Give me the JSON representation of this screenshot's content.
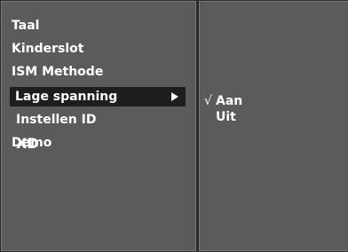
{
  "menu": {
    "items": [
      {
        "label": "Taal"
      },
      {
        "label": "Kinderslot"
      },
      {
        "label": "ISM Methode"
      },
      {
        "label": "Lage spanning"
      },
      {
        "label": "Instellen ID"
      },
      {
        "label": "Demo",
        "logo_text": "XD"
      }
    ],
    "selected_index": 3,
    "arrow_icon": "triangle-right-icon"
  },
  "submenu": {
    "items": [
      {
        "label": "Aan",
        "checked": true
      },
      {
        "label": "Uit",
        "checked": false
      }
    ],
    "check_glyph": "√"
  },
  "colors": {
    "panel": "#5b5b5b",
    "highlight": "#1e1e1e",
    "text": "#ffffff"
  }
}
